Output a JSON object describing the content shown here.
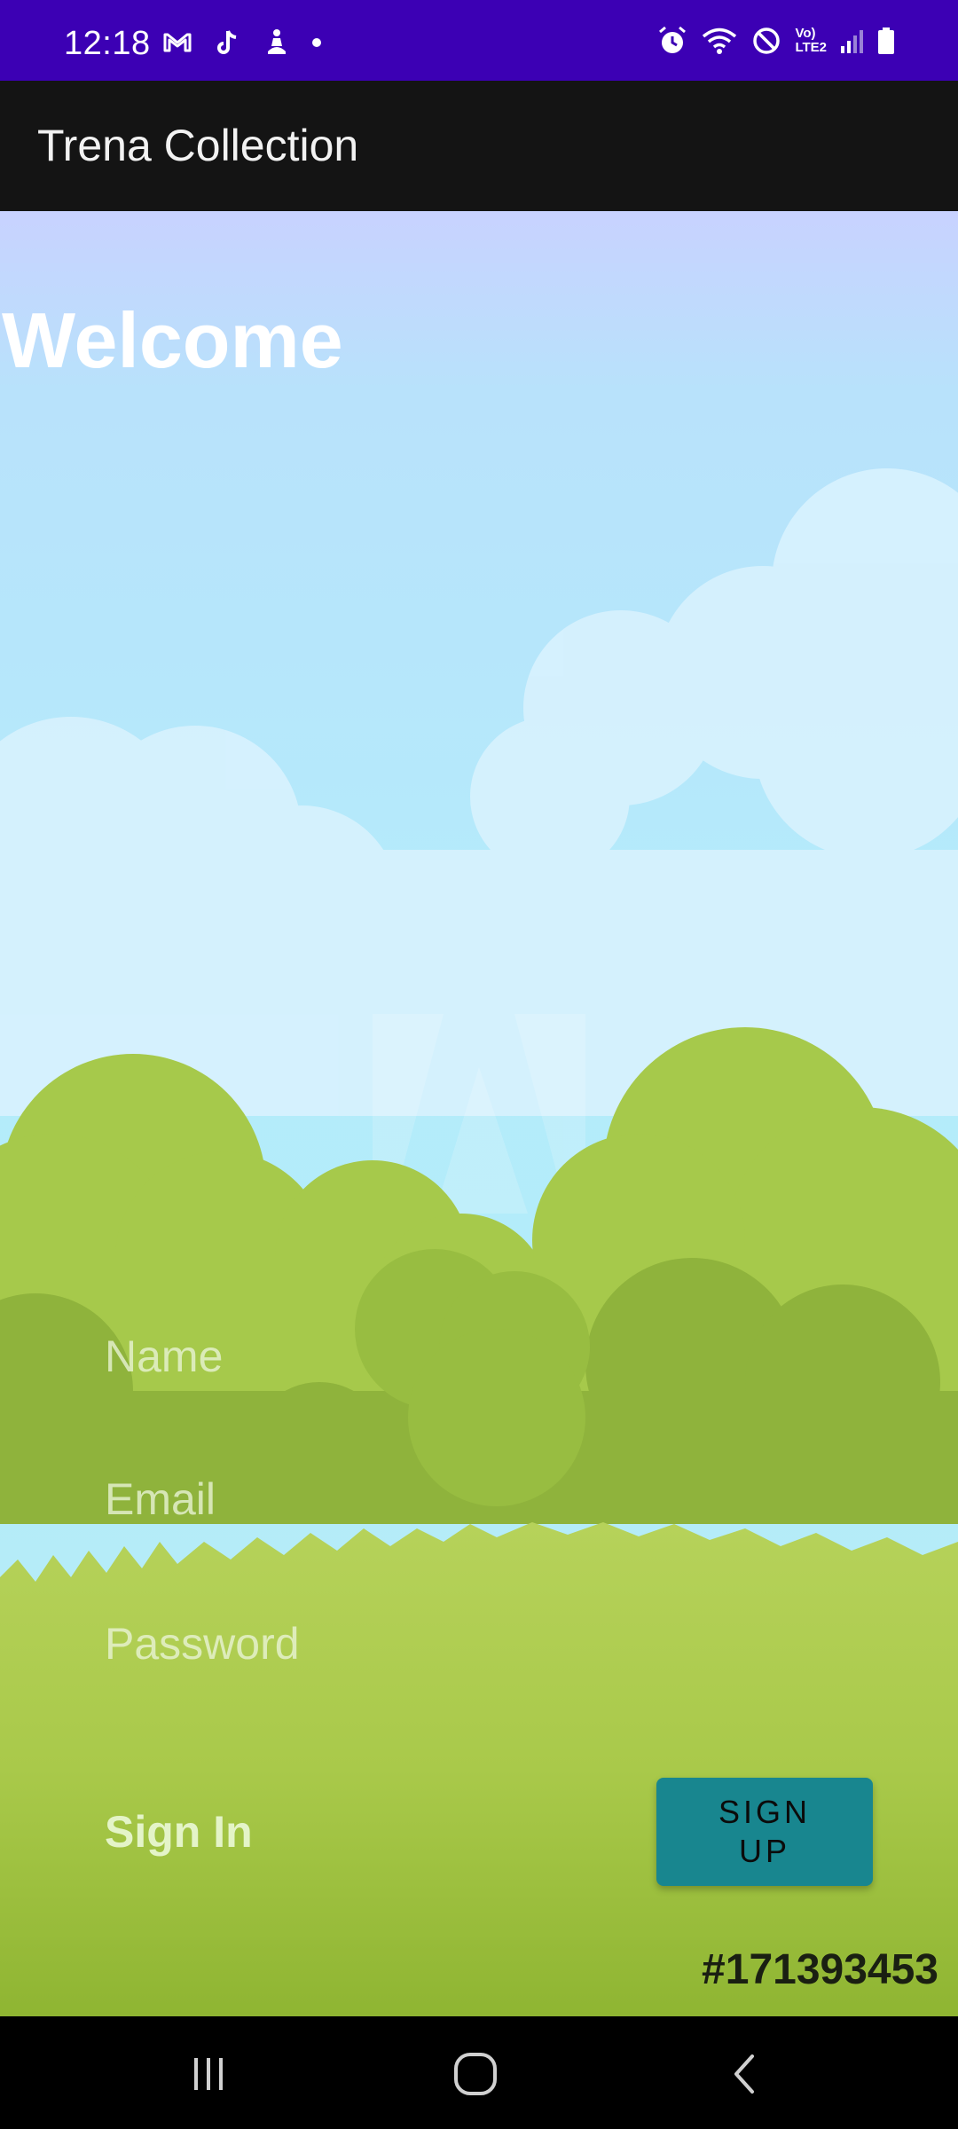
{
  "status_bar": {
    "time": "12:18",
    "network_label_top": "Vo)",
    "network_label_bottom": "LTE2"
  },
  "app_bar": {
    "title": "Trena Collection"
  },
  "main": {
    "welcome": "Welcome",
    "fields": {
      "name_placeholder": "Name",
      "email_placeholder": "Email",
      "password_placeholder": "Password"
    },
    "sign_in_label": "Sign In",
    "sign_up_label": "SIGN UP",
    "watermark": "#171393453"
  },
  "colors": {
    "status_bar": "#3c00b4",
    "app_bar": "#141414",
    "sign_up_button": "#18868f",
    "grass": "#a9c94a"
  },
  "icons": [
    "gmail-icon",
    "tiktok-icon",
    "app-notification-icon",
    "dot-icon",
    "alarm-icon",
    "wifi-icon",
    "do-not-disturb-icon",
    "signal-icon",
    "battery-icon",
    "recent-apps-icon",
    "home-icon",
    "back-icon"
  ]
}
